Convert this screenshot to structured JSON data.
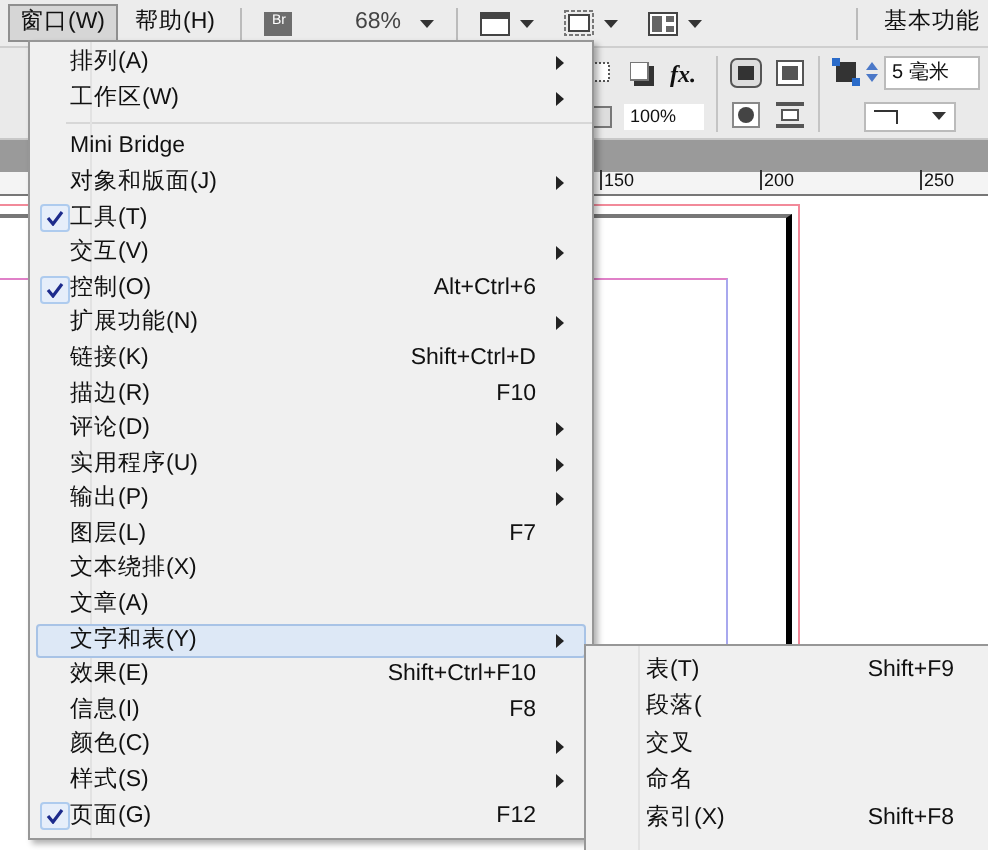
{
  "menu_bar": [
    {
      "label": "窗口(W)",
      "selected": true
    },
    {
      "label": "帮助(H)",
      "selected": false
    }
  ],
  "app_bar": {
    "bridge_label": "Br",
    "zoom": "68%",
    "workspace": "基本功能"
  },
  "control_panel": {
    "fx_label": "fx.",
    "opacity": "100%",
    "stroke_weight": "5 毫米"
  },
  "ruler": {
    "labels": [
      "150",
      "200",
      "250"
    ]
  },
  "window_menu": [
    {
      "kind": "item",
      "label": "排列(A)",
      "submenu": true,
      "checked": false,
      "selected": false
    },
    {
      "kind": "item",
      "label": "工作区(W)",
      "submenu": true,
      "checked": false,
      "selected": false
    },
    {
      "kind": "separator"
    },
    {
      "kind": "item",
      "label": "Mini Bridge",
      "submenu": false,
      "checked": false,
      "selected": false
    },
    {
      "kind": "item",
      "label": "对象和版面(J)",
      "submenu": true,
      "checked": false,
      "selected": false
    },
    {
      "kind": "item",
      "label": "工具(T)",
      "submenu": false,
      "checked": true,
      "selected": false
    },
    {
      "kind": "item",
      "label": "交互(V)",
      "submenu": true,
      "checked": false,
      "selected": false
    },
    {
      "kind": "item",
      "label": "控制(O)",
      "shortcut": "Alt+Ctrl+6",
      "submenu": false,
      "checked": true,
      "selected": false
    },
    {
      "kind": "item",
      "label": "扩展功能(N)",
      "submenu": true,
      "checked": false,
      "selected": false
    },
    {
      "kind": "item",
      "label": "链接(K)",
      "shortcut": "Shift+Ctrl+D",
      "submenu": false,
      "checked": false,
      "selected": false
    },
    {
      "kind": "item",
      "label": "描边(R)",
      "shortcut": "F10",
      "submenu": false,
      "checked": false,
      "selected": false
    },
    {
      "kind": "item",
      "label": "评论(D)",
      "submenu": true,
      "checked": false,
      "selected": false
    },
    {
      "kind": "item",
      "label": "实用程序(U)",
      "submenu": true,
      "checked": false,
      "selected": false
    },
    {
      "kind": "item",
      "label": "输出(P)",
      "submenu": true,
      "checked": false,
      "selected": false
    },
    {
      "kind": "item",
      "label": "图层(L)",
      "shortcut": "F7",
      "submenu": false,
      "checked": false,
      "selected": false
    },
    {
      "kind": "item",
      "label": "文本绕排(X)",
      "submenu": false,
      "checked": false,
      "selected": false
    },
    {
      "kind": "item",
      "label": "文章(A)",
      "submenu": false,
      "checked": false,
      "selected": false
    },
    {
      "kind": "item",
      "label": "文字和表(Y)",
      "submenu": true,
      "checked": false,
      "selected": true
    },
    {
      "kind": "item",
      "label": "效果(E)",
      "shortcut": "Shift+Ctrl+F10",
      "submenu": false,
      "checked": false,
      "selected": false
    },
    {
      "kind": "item",
      "label": "信息(I)",
      "shortcut": "F8",
      "submenu": false,
      "checked": false,
      "selected": false
    },
    {
      "kind": "item",
      "label": "颜色(C)",
      "submenu": true,
      "checked": false,
      "selected": false
    },
    {
      "kind": "item",
      "label": "样式(S)",
      "submenu": true,
      "checked": false,
      "selected": false
    },
    {
      "kind": "item",
      "label": "页面(G)",
      "shortcut": "F12",
      "submenu": false,
      "checked": true,
      "selected": false
    }
  ],
  "type_tables_submenu": [
    {
      "label": "表(T)",
      "shortcut": "Shift+F9"
    },
    {
      "label": "段落("
    },
    {
      "label": "交叉"
    },
    {
      "label": "命名"
    },
    {
      "label": "索引(X)",
      "shortcut": "Shift+F8"
    }
  ]
}
